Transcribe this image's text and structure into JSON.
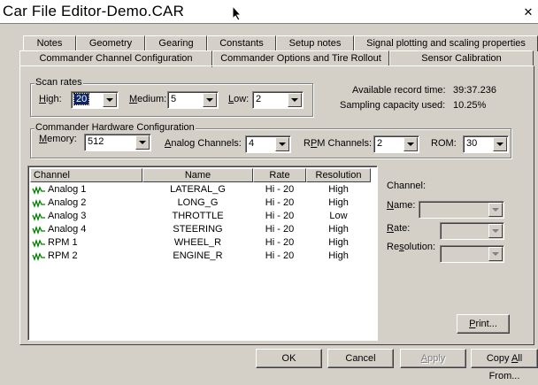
{
  "window": {
    "title": "Car File Editor-Demo.CAR",
    "close_glyph": "✕"
  },
  "tabs": {
    "row1": [
      "Notes",
      "Geometry",
      "Gearing",
      "Constants",
      "Setup notes",
      "Signal plotting and scaling properties"
    ],
    "row2": [
      "Commander Channel Configuration",
      "Commander Options and Tire Rollout",
      "Sensor Calibration"
    ],
    "active": "Commander Channel Configuration"
  },
  "scan_rates": {
    "group_label": "Scan rates",
    "high_label": "High:",
    "high_value": "20",
    "medium_label": "Medium:",
    "medium_value": "5",
    "low_label": "Low:",
    "low_value": "2"
  },
  "record": {
    "time_label": "Available record time:",
    "time_value": "39:37.236",
    "capacity_label": "Sampling capacity used:",
    "capacity_value": "10.25%"
  },
  "hardware": {
    "group_label": "Commander Hardware Configuration",
    "memory_label": "Memory:",
    "memory_value": "512",
    "analog_label": "Analog Channels:",
    "analog_value": "4",
    "rpm_label": "RPM Channels:",
    "rpm_value": "2",
    "rom_label": "ROM:",
    "rom_value": "30"
  },
  "channel_list": {
    "headers": [
      "Channel",
      "Name",
      "Rate",
      "Resolution"
    ],
    "rows": [
      [
        "Analog 1",
        "LATERAL_G",
        "Hi - 20",
        "High"
      ],
      [
        "Analog 2",
        "LONG_G",
        "Hi - 20",
        "High"
      ],
      [
        "Analog 3",
        "THROTTLE",
        "Hi - 20",
        "Low"
      ],
      [
        "Analog 4",
        "STEERING",
        "Hi - 20",
        "High"
      ],
      [
        "RPM 1",
        "WHEEL_R",
        "Hi - 20",
        "High"
      ],
      [
        "RPM 2",
        "ENGINE_R",
        "Hi - 20",
        "High"
      ]
    ]
  },
  "detail": {
    "channel_label": "Channel:",
    "name_label": "Name:",
    "rate_label": "Rate:",
    "resolution_label": "Resolution:",
    "print_label": "Print..."
  },
  "buttons": {
    "ok": "OK",
    "cancel": "Cancel",
    "apply": "Apply",
    "copy_all": "Copy All From..."
  },
  "colors": {
    "face": "#d4d0c8",
    "selection": "#0a246a",
    "icon": "#008000"
  }
}
